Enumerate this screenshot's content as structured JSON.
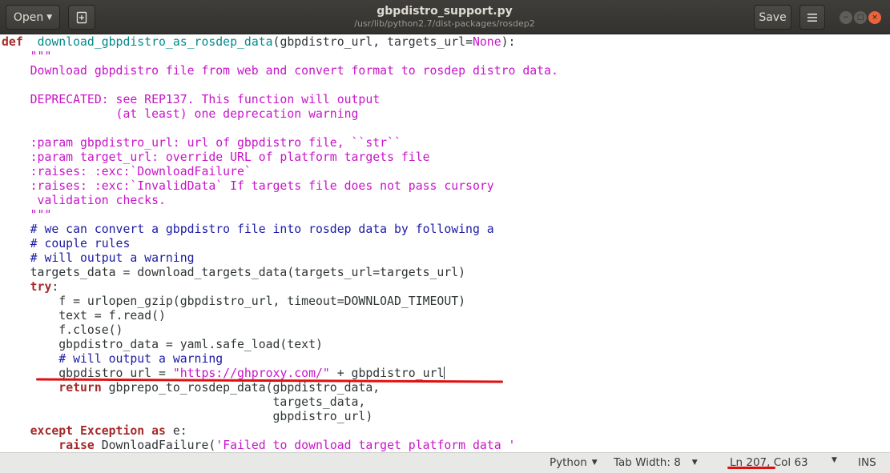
{
  "window": {
    "title": "gbpdistro_support.py",
    "subtitle": "/usr/lib/python2.7/dist-packages/rosdep2",
    "open_label": "Open",
    "save_label": "Save",
    "minimize_glyph": "−",
    "maximize_glyph": "□",
    "close_glyph": "×"
  },
  "icons": {
    "new_document": "new-document-icon",
    "hamburger_menu": "hamburger-menu-icon",
    "dropdown": "chevron-down-icon"
  },
  "editor": {
    "language": "python",
    "lines": [
      [
        [
          "k",
          "def"
        ],
        [
          "",
          "  "
        ],
        [
          "fn",
          "download_gbpdistro_as_rosdep_data"
        ],
        [
          "",
          "(gbpdistro_url, targets_url="
        ],
        [
          "bi",
          "None"
        ],
        [
          "",
          "):"
        ]
      ],
      [
        [
          "",
          "    "
        ],
        [
          "s",
          "\"\"\""
        ]
      ],
      [
        [
          "",
          "    "
        ],
        [
          "s",
          "Download gbpdistro file from web and convert format to rosdep distro data."
        ]
      ],
      [
        [
          "",
          ""
        ]
      ],
      [
        [
          "",
          "    "
        ],
        [
          "s",
          "DEPRECATED: see REP137. This function will output"
        ]
      ],
      [
        [
          "",
          "    "
        ],
        [
          "s",
          "            (at least) one deprecation warning"
        ]
      ],
      [
        [
          "",
          ""
        ]
      ],
      [
        [
          "",
          "    "
        ],
        [
          "s",
          ":param gbpdistro_url: url of gbpdistro file, ``str``"
        ]
      ],
      [
        [
          "",
          "    "
        ],
        [
          "s",
          ":param target_url: override URL of platform targets file"
        ]
      ],
      [
        [
          "",
          "    "
        ],
        [
          "s",
          ":raises: :exc:`DownloadFailure`"
        ]
      ],
      [
        [
          "",
          "    "
        ],
        [
          "s",
          ":raises: :exc:`InvalidData` If targets file does not pass cursory"
        ]
      ],
      [
        [
          "",
          "    "
        ],
        [
          "s",
          " validation checks."
        ]
      ],
      [
        [
          "",
          "    "
        ],
        [
          "s",
          "\"\"\""
        ]
      ],
      [
        [
          "",
          "    "
        ],
        [
          "c",
          "# we can convert a gbpdistro file into rosdep data by following a"
        ]
      ],
      [
        [
          "",
          "    "
        ],
        [
          "c",
          "# couple rules"
        ]
      ],
      [
        [
          "",
          "    "
        ],
        [
          "c",
          "# will output a warning"
        ]
      ],
      [
        [
          "",
          "    targets_data = download_targets_data(targets_url=targets_url)"
        ]
      ],
      [
        [
          "",
          "    "
        ],
        [
          "k",
          "try"
        ],
        [
          "",
          ":"
        ]
      ],
      [
        [
          "",
          "        f = urlopen_gzip(gbpdistro_url, timeout=DOWNLOAD_TIMEOUT)"
        ]
      ],
      [
        [
          "",
          "        text = f.read()"
        ]
      ],
      [
        [
          "",
          "        f.close()"
        ]
      ],
      [
        [
          "",
          "        gbpdistro_data = yaml.safe_load(text)"
        ]
      ],
      [
        [
          "",
          "        "
        ],
        [
          "c",
          "# will output a warning"
        ]
      ],
      [
        [
          "",
          "        gbpdistro_url = "
        ],
        [
          "s",
          "\"https://ghproxy.com/\""
        ],
        [
          "",
          " + gbpdistro_url"
        ],
        [
          "cursor",
          ""
        ]
      ],
      [
        [
          "",
          "        "
        ],
        [
          "k",
          "return"
        ],
        [
          "",
          " gbprepo_to_rosdep_data(gbpdistro_data,"
        ]
      ],
      [
        [
          "",
          "                                      targets_data,"
        ]
      ],
      [
        [
          "",
          "                                      gbpdistro_url)"
        ]
      ],
      [
        [
          "",
          "    "
        ],
        [
          "k",
          "except"
        ],
        [
          "",
          " "
        ],
        [
          "k",
          "Exception"
        ],
        [
          "",
          " "
        ],
        [
          "k",
          "as"
        ],
        [
          "",
          " e:"
        ]
      ],
      [
        [
          "",
          "        "
        ],
        [
          "k",
          "raise"
        ],
        [
          "",
          " DownloadFailure("
        ],
        [
          "s",
          "'Failed to download target platform data '"
        ]
      ]
    ]
  },
  "statusbar": {
    "language": "Python",
    "tab_width": "Tab Width: 8",
    "position": "Ln 207, Col 63",
    "mode": "INS"
  },
  "colors": {
    "headerbar": "#3a3936",
    "keyword": "#a52a2a",
    "function": "#008a8c",
    "string": "#c814c8",
    "comment": "#1a1aa6",
    "annotation": "#e01010",
    "close_button": "#e9643a"
  }
}
